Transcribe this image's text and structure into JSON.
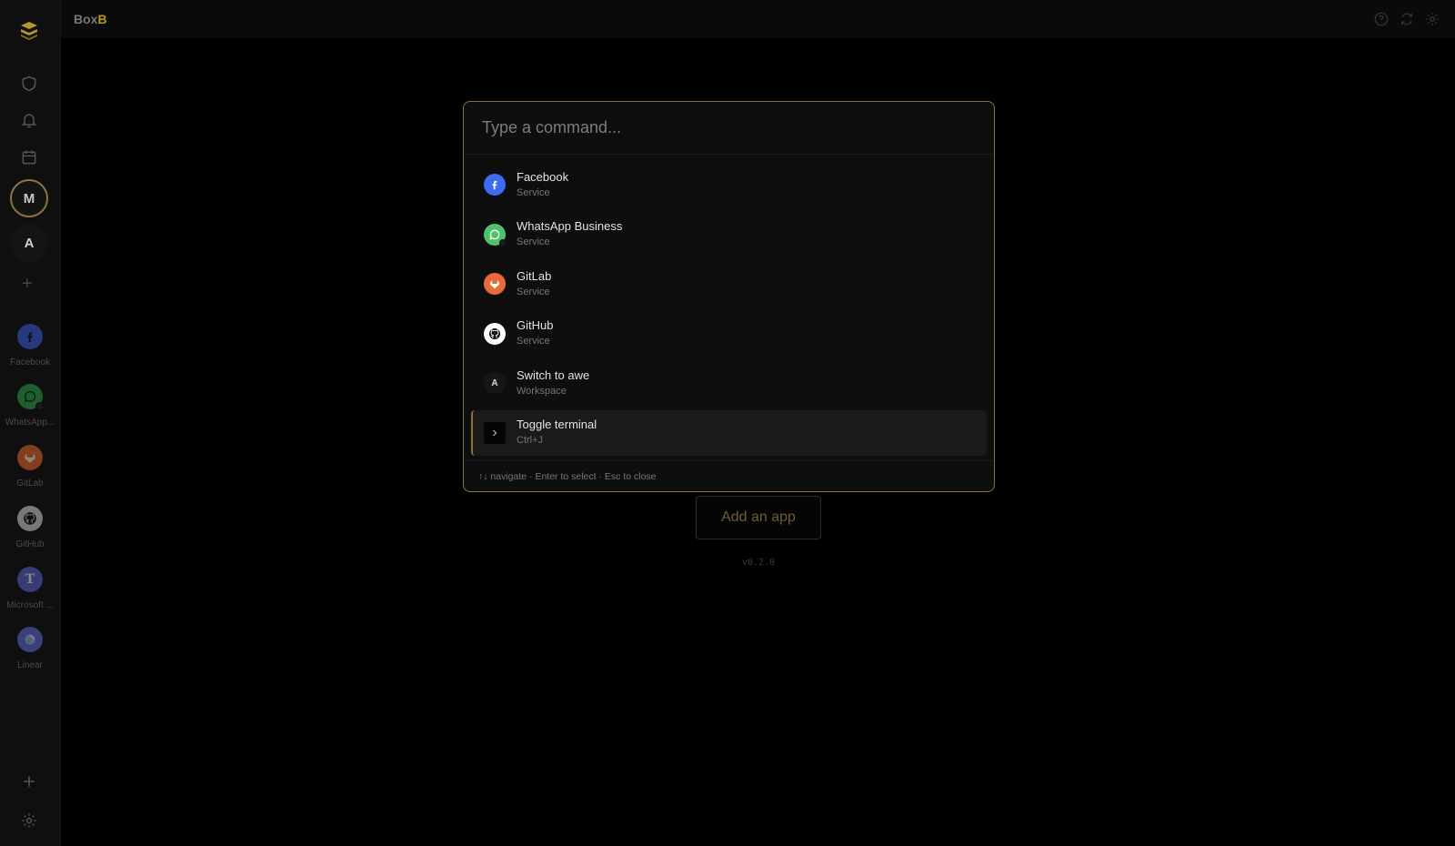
{
  "app": {
    "title_prefix": "Box",
    "title_accent": "B",
    "accent_color": "#b8962e"
  },
  "sidebar": {
    "top_icons": [
      "shield-icon",
      "bell-icon",
      "calendar-icon"
    ],
    "workspaces": [
      {
        "initial": "M",
        "active": true
      },
      {
        "initial": "A",
        "active": false
      }
    ],
    "add_workspace_label": "+",
    "apps": [
      {
        "label": "Facebook",
        "icon": "facebook-icon",
        "color": "#3b5bdb"
      },
      {
        "label": "WhatsApp...",
        "icon": "whatsapp-icon",
        "color": "#2e9e4a"
      },
      {
        "label": "GitLab",
        "icon": "gitlab-icon",
        "color": "#e2652b"
      },
      {
        "label": "GitHub",
        "icon": "github-icon",
        "color": "#cfcfcf"
      },
      {
        "label": "Microsoft ...",
        "icon": "teams-icon",
        "color": "#5b5fc7"
      },
      {
        "label": "Linear",
        "icon": "linear-icon",
        "color": "#5e6ad2"
      }
    ],
    "bottom_icons": [
      "plus-icon",
      "settings-icon"
    ]
  },
  "topbar": {
    "icons": [
      "help-icon",
      "refresh-icon",
      "settings-icon"
    ]
  },
  "main": {
    "add_app_label": "Add an app",
    "version": "v0.2.0"
  },
  "palette": {
    "placeholder": "Type a command...",
    "items": [
      {
        "title": "Facebook",
        "subtitle": "Service",
        "icon": "facebook-icon",
        "color": "#3c6cf2"
      },
      {
        "title": "WhatsApp Business",
        "subtitle": "Service",
        "icon": "whatsapp-icon",
        "color": "#4cc36a"
      },
      {
        "title": "GitLab",
        "subtitle": "Service",
        "icon": "gitlab-icon",
        "color": "#e86c3a"
      },
      {
        "title": "GitHub",
        "subtitle": "Service",
        "icon": "github-icon",
        "color": "#ffffff"
      },
      {
        "title": "Switch to awe",
        "subtitle": "Workspace",
        "icon": "workspace-a-icon",
        "initial": "A"
      },
      {
        "title": "Toggle terminal",
        "subtitle": "Ctrl+J",
        "icon": "chevron-right-icon",
        "selected": true
      }
    ],
    "footer": "↑↓ navigate · Enter to select · Esc to close"
  }
}
